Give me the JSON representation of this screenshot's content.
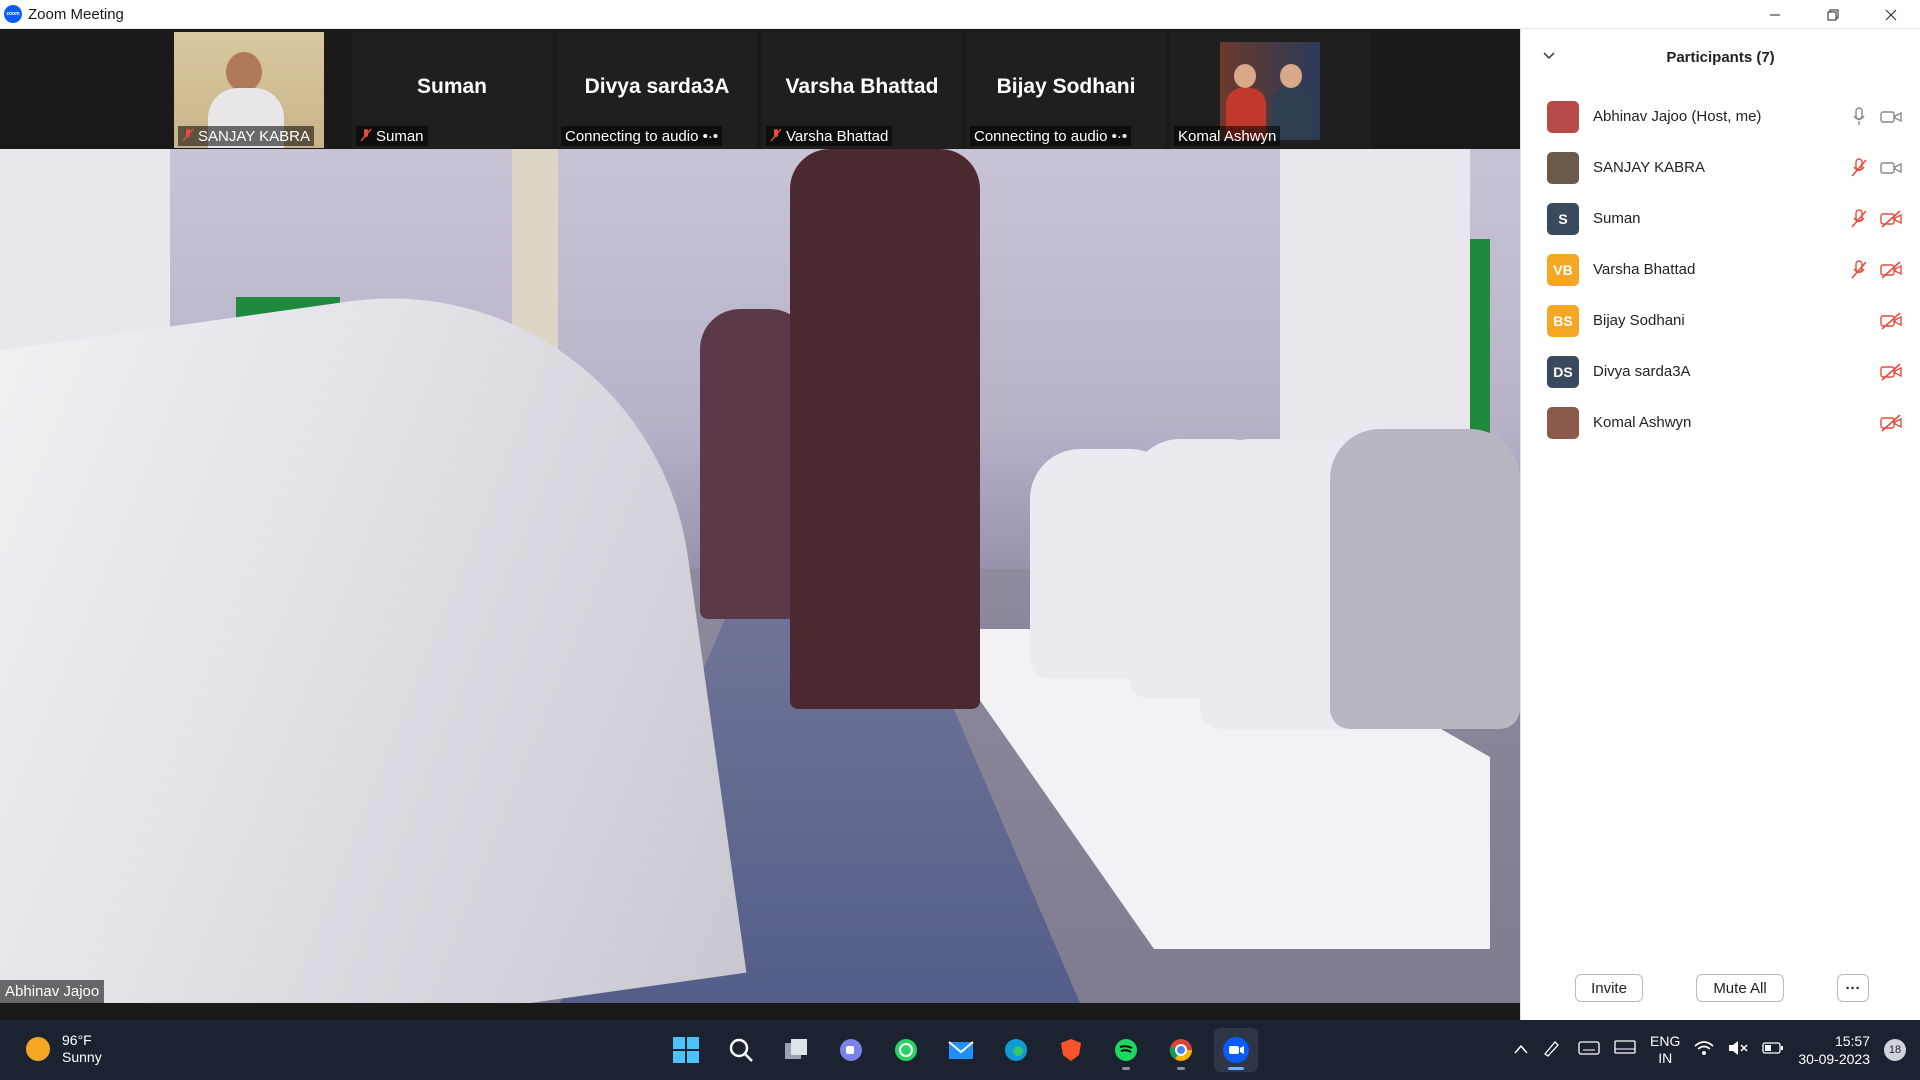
{
  "window": {
    "title": "Zoom Meeting",
    "logo_text": "zoom"
  },
  "strip": {
    "tiles": [
      {
        "label": "SANJAY KABRA",
        "big_name": "",
        "muted": true
      },
      {
        "label": "Suman",
        "big_name": "Suman",
        "muted": true
      },
      {
        "label": "Connecting to audio •·•",
        "big_name": "Divya sarda3A",
        "muted": false
      },
      {
        "label": "Varsha Bhattad",
        "big_name": "Varsha Bhattad",
        "muted": true
      },
      {
        "label": "Connecting to audio •·•",
        "big_name": "Bijay Sodhani",
        "muted": false
      },
      {
        "label": "Komal Ashwyn",
        "big_name": "",
        "muted": false
      }
    ]
  },
  "main_video": {
    "speaker": "Abhinav Jajoo"
  },
  "participants": {
    "title": "Participants (7)",
    "items": [
      {
        "name": "Abhinav Jajoo (Host, me)",
        "initials": "",
        "avatar_color": "#b84a4a",
        "mic": "on",
        "video": "on"
      },
      {
        "name": "SANJAY KABRA",
        "initials": "",
        "avatar_color": "#6b5a4a",
        "mic": "off",
        "video": "on"
      },
      {
        "name": "Suman",
        "initials": "S",
        "avatar_color": "#3a4a5e",
        "mic": "off",
        "video": "off"
      },
      {
        "name": "Varsha Bhattad",
        "initials": "VB",
        "avatar_color": "#f5a623",
        "mic": "off",
        "video": "off"
      },
      {
        "name": "Bijay Sodhani",
        "initials": "BS",
        "avatar_color": "#f5a623",
        "mic": "none",
        "video": "off"
      },
      {
        "name": "Divya sarda3A",
        "initials": "DS",
        "avatar_color": "#3a4a5e",
        "mic": "none",
        "video": "off"
      },
      {
        "name": "Komal Ashwyn",
        "initials": "",
        "avatar_color": "#8a5a4a",
        "mic": "none",
        "video": "off"
      }
    ],
    "invite_label": "Invite",
    "mute_all_label": "Mute All",
    "more_label": "···"
  },
  "taskbar": {
    "weather_temp": "96°F",
    "weather_desc": "Sunny",
    "lang_1": "ENG",
    "lang_2": "IN",
    "time": "15:57",
    "date": "30-09-2023",
    "notifications": "18",
    "apps": [
      "windows-start",
      "search",
      "task-view",
      "teams-chat",
      "whatsapp",
      "mail",
      "edge",
      "brave",
      "spotify",
      "chrome",
      "zoom"
    ]
  },
  "colors": {
    "accent": "#0b5cff",
    "muted_red": "#e74c3c",
    "taskbar": "#1c2330"
  }
}
